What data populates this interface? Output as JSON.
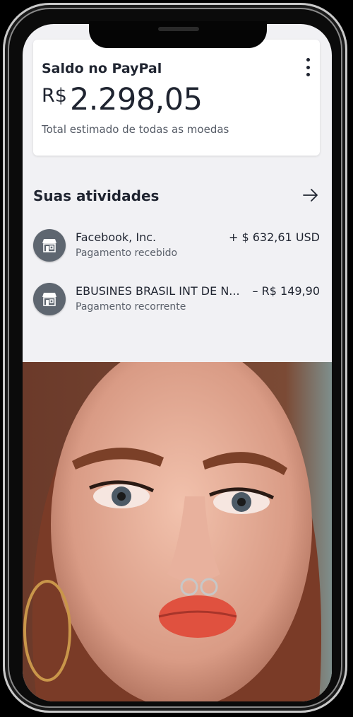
{
  "balance": {
    "title": "Saldo no PayPal",
    "currency_symbol": "R$",
    "amount": "2.298,05",
    "subtitle": "Total estimado de todas as moedas",
    "menu_icon": "more-vertical-icon"
  },
  "activities": {
    "title": "Suas atividades",
    "arrow_icon": "arrow-right-icon",
    "items": [
      {
        "name": "Facebook, Inc.",
        "description": "Pagamento recebido",
        "amount": "+ $ 632,61 USD",
        "icon": "store-icon"
      },
      {
        "name": "EBUSINES BRASIL INT DE N...",
        "description": "Pagamento recorrente",
        "amount": "– R$ 149,90",
        "icon": "store-icon"
      }
    ]
  },
  "colors": {
    "screen_bg": "#f1f1f4",
    "card_bg": "#ffffff",
    "text_primary": "#1f2430",
    "text_secondary": "#5b616b",
    "avatar_bg": "#5e6670"
  }
}
